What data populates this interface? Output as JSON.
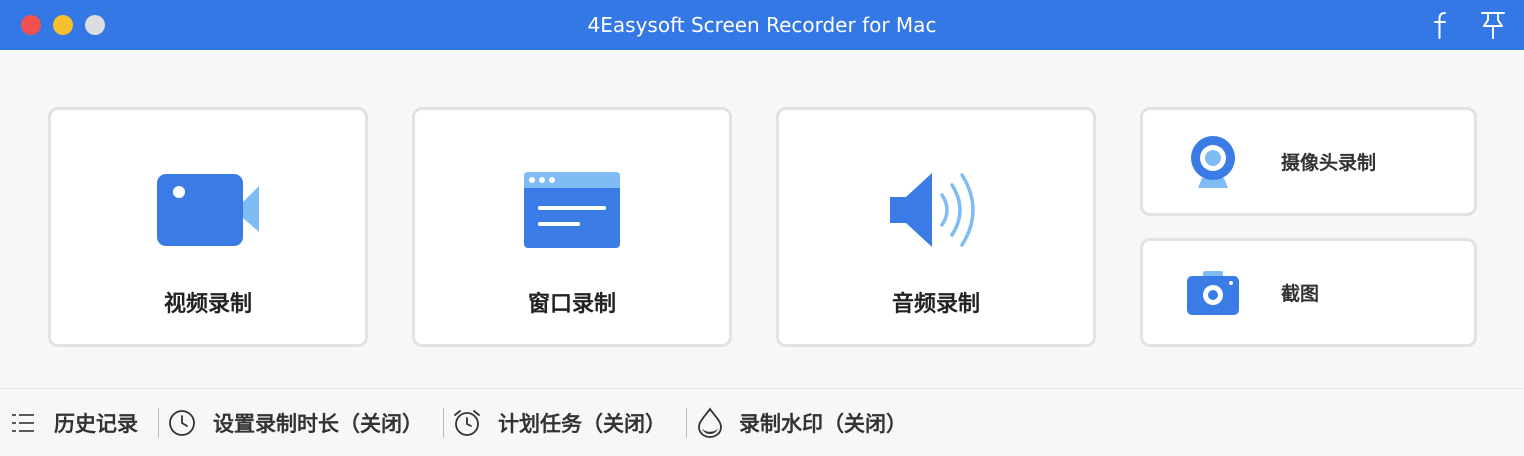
{
  "window": {
    "title": "4Easysoft Screen Recorder for Mac"
  },
  "modes": {
    "video": {
      "label": "视频录制",
      "icon": "video-camera-icon"
    },
    "window": {
      "label": "窗口录制",
      "icon": "browser-window-icon"
    },
    "audio": {
      "label": "音频录制",
      "icon": "speaker-icon"
    },
    "webcam": {
      "label": "摄像头录制",
      "icon": "webcam-icon"
    },
    "screenshot": {
      "label": "截图",
      "icon": "camera-icon"
    }
  },
  "bottom_bar": {
    "history": {
      "label": "历史记录",
      "icon": "list-icon"
    },
    "duration": {
      "label": "设置录制时长",
      "status": "（关闭）",
      "icon": "clock-icon"
    },
    "schedule": {
      "label": "计划任务",
      "status": "（关闭）",
      "icon": "alarm-clock-icon"
    },
    "watermark": {
      "label": "录制水印",
      "status": "（关闭）",
      "icon": "water-drop-icon"
    }
  },
  "colors": {
    "titlebar": "#3478e6",
    "accent": "#3a7be6",
    "accent_light": "#7fbcf5"
  }
}
